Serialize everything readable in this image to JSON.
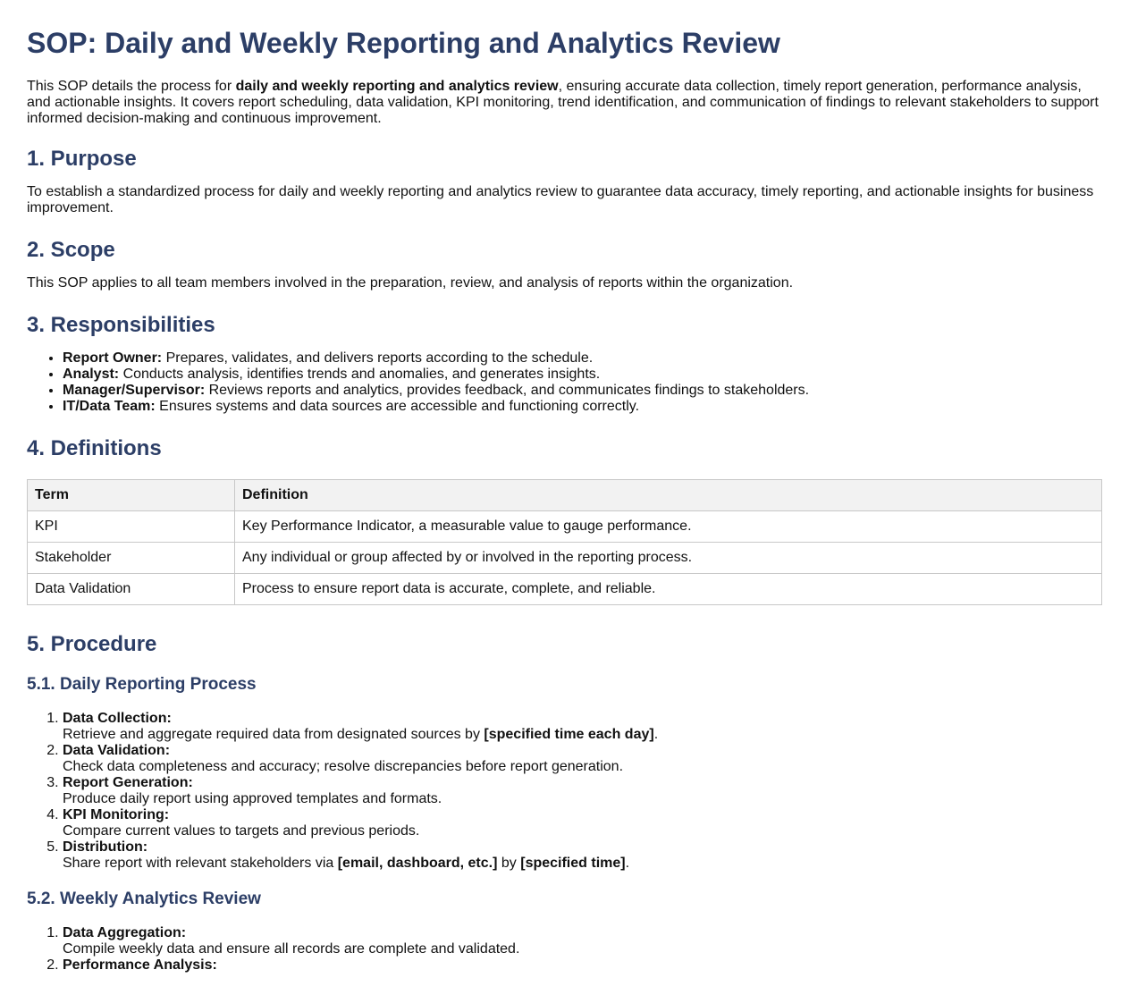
{
  "title": "SOP: Daily and Weekly Reporting and Analytics Review",
  "intro": {
    "before": "This SOP details the process for ",
    "bold": "daily and weekly reporting and analytics review",
    "after": ", ensuring accurate data collection, timely report generation, performance analysis, and actionable insights. It covers report scheduling, data validation, KPI monitoring, trend identification, and communication of findings to relevant stakeholders to support informed decision-making and continuous improvement."
  },
  "purpose": {
    "heading": "1. Purpose",
    "text": "To establish a standardized process for daily and weekly reporting and analytics review to guarantee data accuracy, timely reporting, and actionable insights for business improvement."
  },
  "scope": {
    "heading": "2. Scope",
    "text": "This SOP applies to all team members involved in the preparation, review, and analysis of reports within the organization."
  },
  "responsibilities": {
    "heading": "3. Responsibilities",
    "items": [
      {
        "role": "Report Owner:",
        "desc": " Prepares, validates, and delivers reports according to the schedule."
      },
      {
        "role": "Analyst:",
        "desc": " Conducts analysis, identifies trends and anomalies, and generates insights."
      },
      {
        "role": "Manager/Supervisor:",
        "desc": " Reviews reports and analytics, provides feedback, and communicates findings to stakeholders."
      },
      {
        "role": "IT/Data Team:",
        "desc": " Ensures systems and data sources are accessible and functioning correctly."
      }
    ]
  },
  "definitions": {
    "heading": "4. Definitions",
    "col_term": "Term",
    "col_definition": "Definition",
    "rows": [
      {
        "term": "KPI",
        "definition": "Key Performance Indicator, a measurable value to gauge performance."
      },
      {
        "term": "Stakeholder",
        "definition": "Any individual or group affected by or involved in the reporting process."
      },
      {
        "term": "Data Validation",
        "definition": "Process to ensure report data is accurate, complete, and reliable."
      }
    ]
  },
  "procedure": {
    "heading": "5. Procedure",
    "daily": {
      "heading": "5.1. Daily Reporting Process",
      "steps": [
        {
          "title": "Data Collection:",
          "pre": "Retrieve and aggregate required data from designated sources by ",
          "b1": "[specified time each day]",
          "mid": ".",
          "b2": "",
          "post": ""
        },
        {
          "title": "Data Validation:",
          "pre": "Check data completeness and accuracy; resolve discrepancies before report generation.",
          "b1": "",
          "mid": "",
          "b2": "",
          "post": ""
        },
        {
          "title": "Report Generation:",
          "pre": "Produce daily report using approved templates and formats.",
          "b1": "",
          "mid": "",
          "b2": "",
          "post": ""
        },
        {
          "title": "KPI Monitoring:",
          "pre": "Compare current values to targets and previous periods.",
          "b1": "",
          "mid": "",
          "b2": "",
          "post": ""
        },
        {
          "title": "Distribution:",
          "pre": "Share report with relevant stakeholders via ",
          "b1": "[email, dashboard, etc.]",
          "mid": " by ",
          "b2": "[specified time]",
          "post": "."
        }
      ]
    },
    "weekly": {
      "heading": "5.2. Weekly Analytics Review",
      "steps": [
        {
          "title": "Data Aggregation:",
          "pre": "Compile weekly data and ensure all records are complete and validated.",
          "b1": "",
          "mid": "",
          "b2": "",
          "post": ""
        },
        {
          "title": "Performance Analysis:",
          "pre": "",
          "b1": "",
          "mid": "",
          "b2": "",
          "post": ""
        }
      ]
    }
  }
}
